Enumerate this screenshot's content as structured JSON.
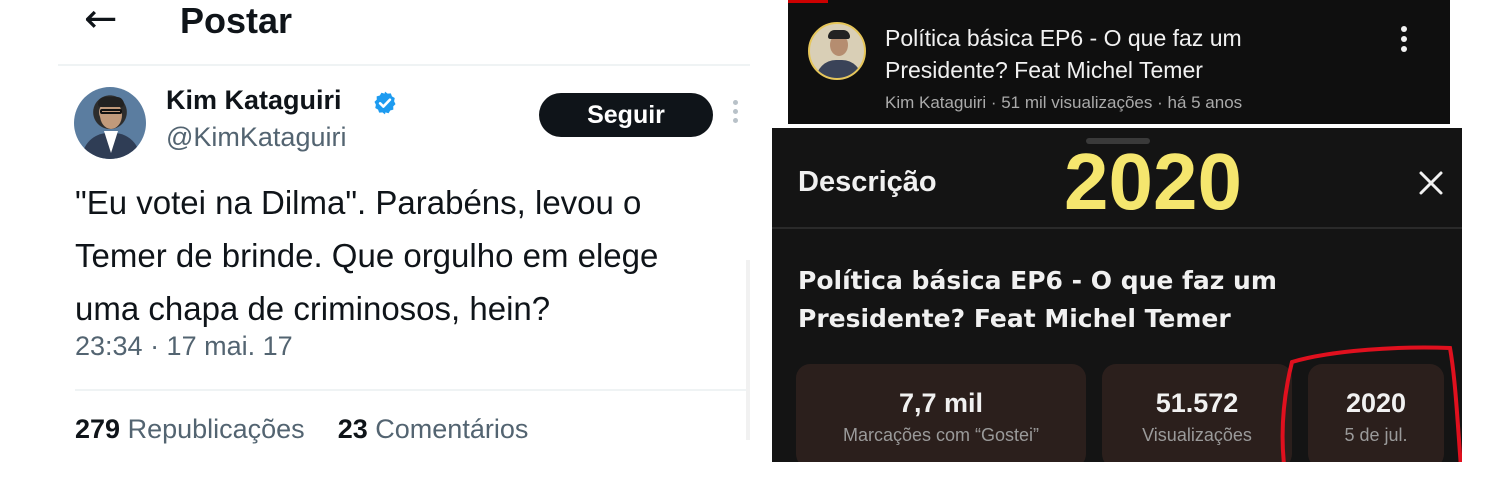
{
  "tweet": {
    "back_icon": "arrow-left-icon",
    "header_title": "Postar",
    "author_name": "Kim Kataguiri",
    "author_handle": "@KimKataguiri",
    "verified_icon": "verified-badge-icon",
    "follow_label": "Seguir",
    "text_lines": [
      "\"Eu votei na Dilma\". Parabéns, levou o",
      "Temer de brinde. Que orgulho em elege",
      "uma chapa de criminosos, hein?"
    ],
    "timestamp": "23:34 · 17 mai. 17",
    "stats": {
      "reposts_count": "279",
      "reposts_label": "Republicações",
      "comments_count": "23",
      "comments_label": "Comentários"
    }
  },
  "youtube_card": {
    "title": "Política básica EP6 - O que faz um Presidente? Feat Michel Temer",
    "meta": "Kim Kataguiri · 51 mil visualizações · há 5 anos",
    "menu_icon": "more-vertical-icon"
  },
  "description_panel": {
    "heading": "Descrição",
    "year_overlay": "2020",
    "close_icon": "close-icon",
    "video_title": "Política básica EP6 - O que faz um Presidente? Feat Michel Temer",
    "stats": [
      {
        "value": "7,7 mil",
        "label": "Marcações com “Gostei”"
      },
      {
        "value": "51.572",
        "label": "Visualizações"
      },
      {
        "value": "2020",
        "label": "5 de jul."
      }
    ]
  },
  "colors": {
    "follow_button_bg": "#0f1419",
    "verified_blue": "#1d9bf0",
    "overlay_yellow": "#f5e66e",
    "annotation_red": "#e0101e",
    "dark_bg": "#0f0f0f"
  }
}
